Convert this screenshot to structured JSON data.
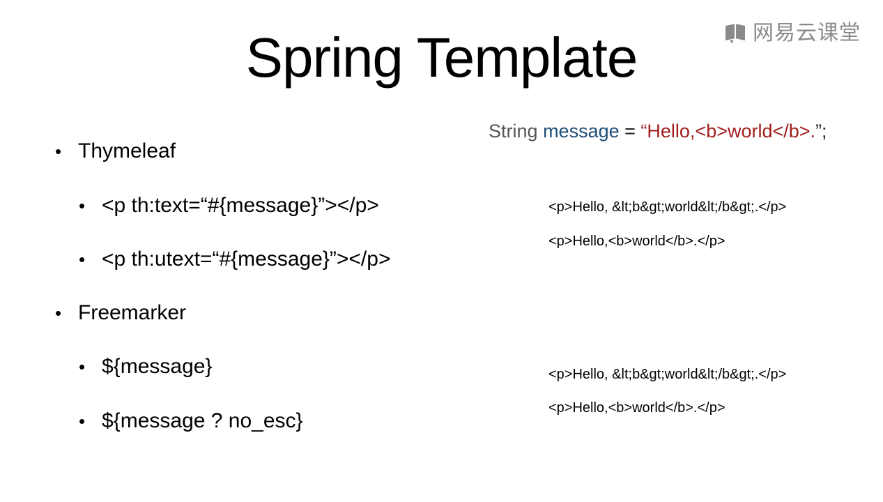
{
  "slide": {
    "title": "Spring Template"
  },
  "logo": {
    "text": "网易云课堂",
    "color": "#8a8a8a"
  },
  "bullets": {
    "thymeleaf": {
      "label": "Thymeleaf",
      "items": [
        "<p th:text=“#{message}”></p>",
        "<p th:utext=“#{message}”></p>"
      ]
    },
    "freemarker": {
      "label": "Freemarker",
      "items": [
        "${message}",
        "${message ? no_esc}"
      ]
    }
  },
  "declaration": {
    "type": "String",
    "variable": "message",
    "operator": " = ",
    "open_quote": "“",
    "value": "Hello,<b>world</b>.",
    "close": "”;",
    "colors": {
      "type": "#555555",
      "variable": "#1f4e79",
      "string": "#a01c1c"
    }
  },
  "outputs": {
    "thymeleaf": [
      "<p>Hello, &lt;b&gt;world&lt;/b&gt;.</p>",
      "<p>Hello,<b>world</b>.</p>"
    ],
    "freemarker": [
      "<p>Hello, &lt;b&gt;world&lt;/b&gt;.</p>",
      "<p>Hello,<b>world</b>.</p>"
    ]
  }
}
